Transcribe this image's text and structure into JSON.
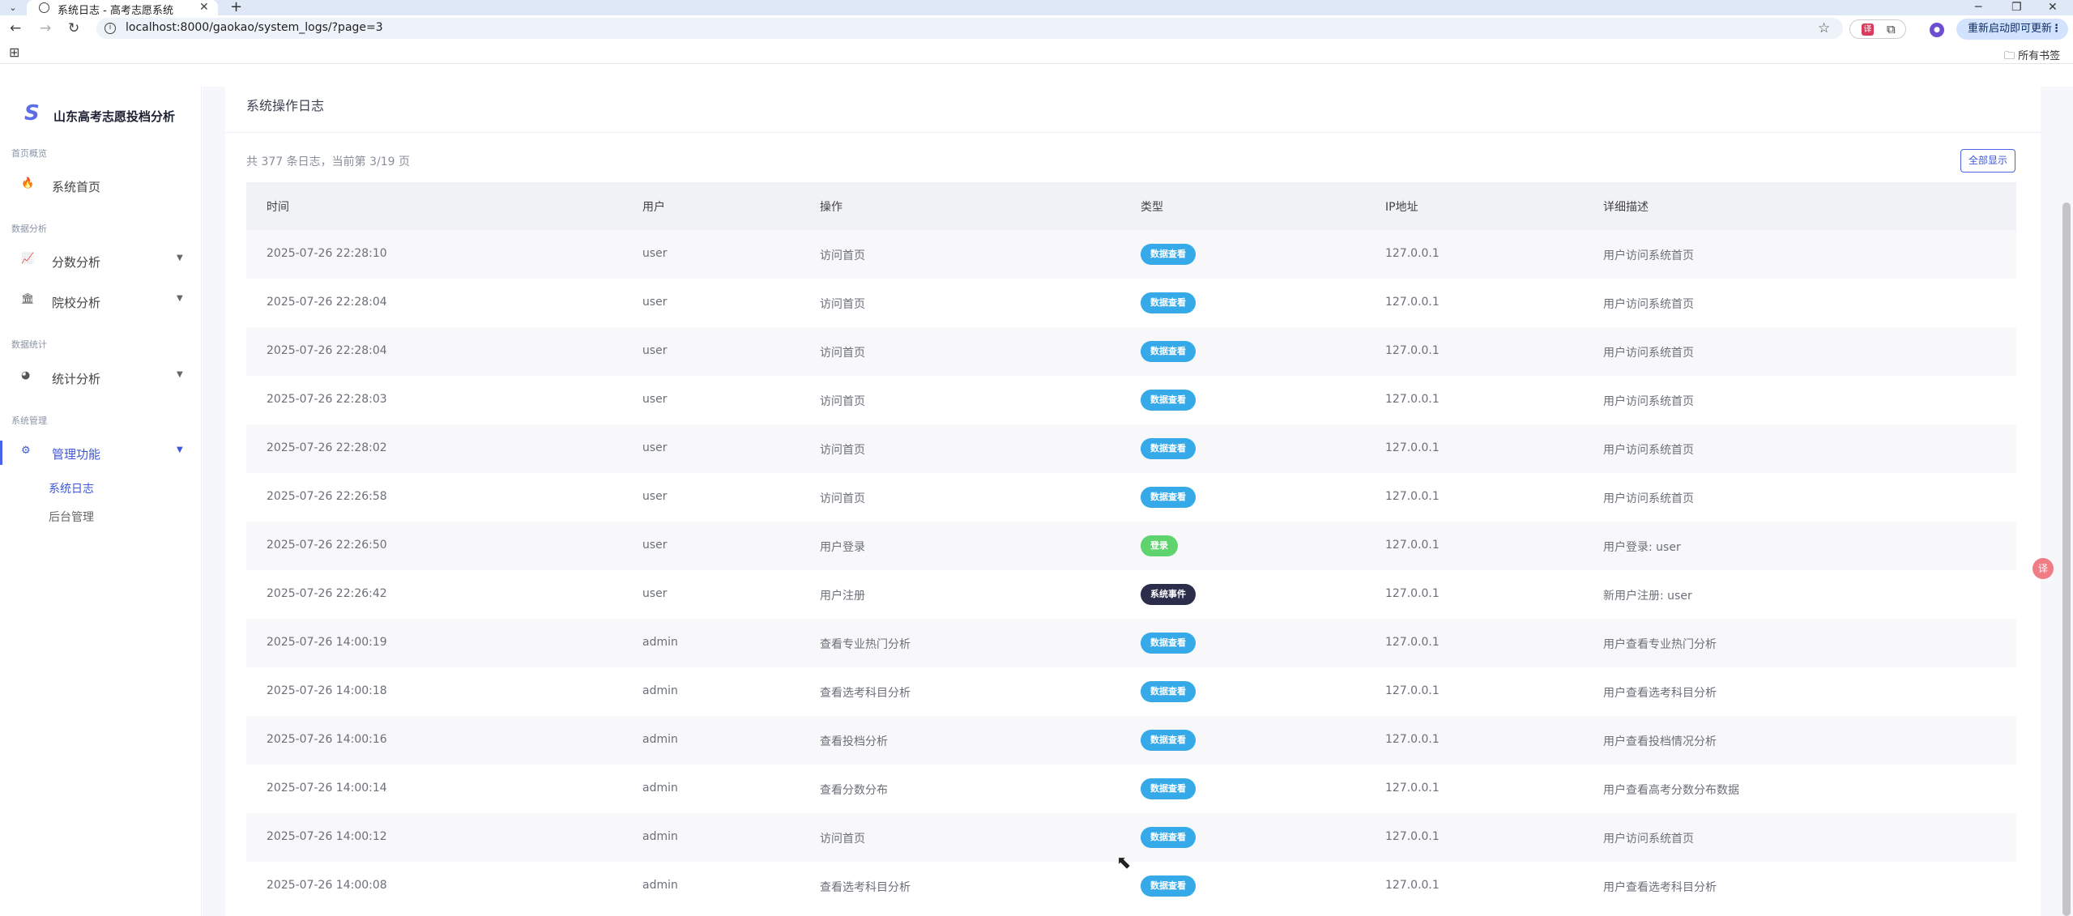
{
  "browser": {
    "tab_title": "系统日志 - 高考志愿系统",
    "url": "localhost:8000/gaokao/system_logs/?page=3",
    "update_button": "重新启动即可更新",
    "bookmarks_folder": "所有书签"
  },
  "sidebar": {
    "brand_logo": "S",
    "brand": "山东高考志愿投档分析",
    "sections": [
      {
        "title": "首页概览",
        "items": [
          {
            "label": "系统首页",
            "icon": "fire-icon"
          }
        ]
      },
      {
        "title": "数据分析",
        "items": [
          {
            "label": "分数分析",
            "icon": "chart-line-icon"
          },
          {
            "label": "院校分析",
            "icon": "university-icon"
          }
        ]
      },
      {
        "title": "数据统计",
        "items": [
          {
            "label": "统计分析",
            "icon": "pie-chart-icon"
          }
        ]
      },
      {
        "title": "系统管理",
        "items": [
          {
            "label": "管理功能",
            "icon": "cogs-icon",
            "active": true,
            "children": [
              "系统日志",
              "后台管理"
            ]
          }
        ]
      }
    ]
  },
  "main": {
    "title": "系统操作日志",
    "summary": "共 377 条日志，当前第 3/19 页",
    "show_all_button": "全部显示",
    "columns": [
      "时间",
      "用户",
      "操作",
      "类型",
      "IP地址",
      "详细描述"
    ],
    "rows": [
      {
        "time": "2025-07-26 22:28:10",
        "user": "user",
        "op": "访问首页",
        "type": "数据查看",
        "ip": "127.0.0.1",
        "desc": "用户访问系统首页"
      },
      {
        "time": "2025-07-26 22:28:04",
        "user": "user",
        "op": "访问首页",
        "type": "数据查看",
        "ip": "127.0.0.1",
        "desc": "用户访问系统首页"
      },
      {
        "time": "2025-07-26 22:28:04",
        "user": "user",
        "op": "访问首页",
        "type": "数据查看",
        "ip": "127.0.0.1",
        "desc": "用户访问系统首页"
      },
      {
        "time": "2025-07-26 22:28:03",
        "user": "user",
        "op": "访问首页",
        "type": "数据查看",
        "ip": "127.0.0.1",
        "desc": "用户访问系统首页"
      },
      {
        "time": "2025-07-26 22:28:02",
        "user": "user",
        "op": "访问首页",
        "type": "数据查看",
        "ip": "127.0.0.1",
        "desc": "用户访问系统首页"
      },
      {
        "time": "2025-07-26 22:26:58",
        "user": "user",
        "op": "访问首页",
        "type": "数据查看",
        "ip": "127.0.0.1",
        "desc": "用户访问系统首页"
      },
      {
        "time": "2025-07-26 22:26:50",
        "user": "user",
        "op": "用户登录",
        "type": "登录",
        "ip": "127.0.0.1",
        "desc": "用户登录: user"
      },
      {
        "time": "2025-07-26 22:26:42",
        "user": "user",
        "op": "用户注册",
        "type": "系统事件",
        "ip": "127.0.0.1",
        "desc": "新用户注册: user"
      },
      {
        "time": "2025-07-26 14:00:19",
        "user": "admin",
        "op": "查看专业热门分析",
        "type": "数据查看",
        "ip": "127.0.0.1",
        "desc": "用户查看专业热门分析"
      },
      {
        "time": "2025-07-26 14:00:18",
        "user": "admin",
        "op": "查看选考科目分析",
        "type": "数据查看",
        "ip": "127.0.0.1",
        "desc": "用户查看选考科目分析"
      },
      {
        "time": "2025-07-26 14:00:16",
        "user": "admin",
        "op": "查看投档分析",
        "type": "数据查看",
        "ip": "127.0.0.1",
        "desc": "用户查看投档情况分析"
      },
      {
        "time": "2025-07-26 14:00:14",
        "user": "admin",
        "op": "查看分数分布",
        "type": "数据查看",
        "ip": "127.0.0.1",
        "desc": "用户查看高考分数分布数据"
      },
      {
        "time": "2025-07-26 14:00:12",
        "user": "admin",
        "op": "访问首页",
        "type": "数据查看",
        "ip": "127.0.0.1",
        "desc": "用户访问系统首页"
      },
      {
        "time": "2025-07-26 14:00:08",
        "user": "admin",
        "op": "查看选考科目分析",
        "type": "数据查看",
        "ip": "127.0.0.1",
        "desc": "用户查看选考科目分析"
      }
    ]
  },
  "badge_colors": {
    "数据查看": "#36a9e8",
    "登录": "#5fd36e",
    "系统事件": "#2b2d4a"
  }
}
